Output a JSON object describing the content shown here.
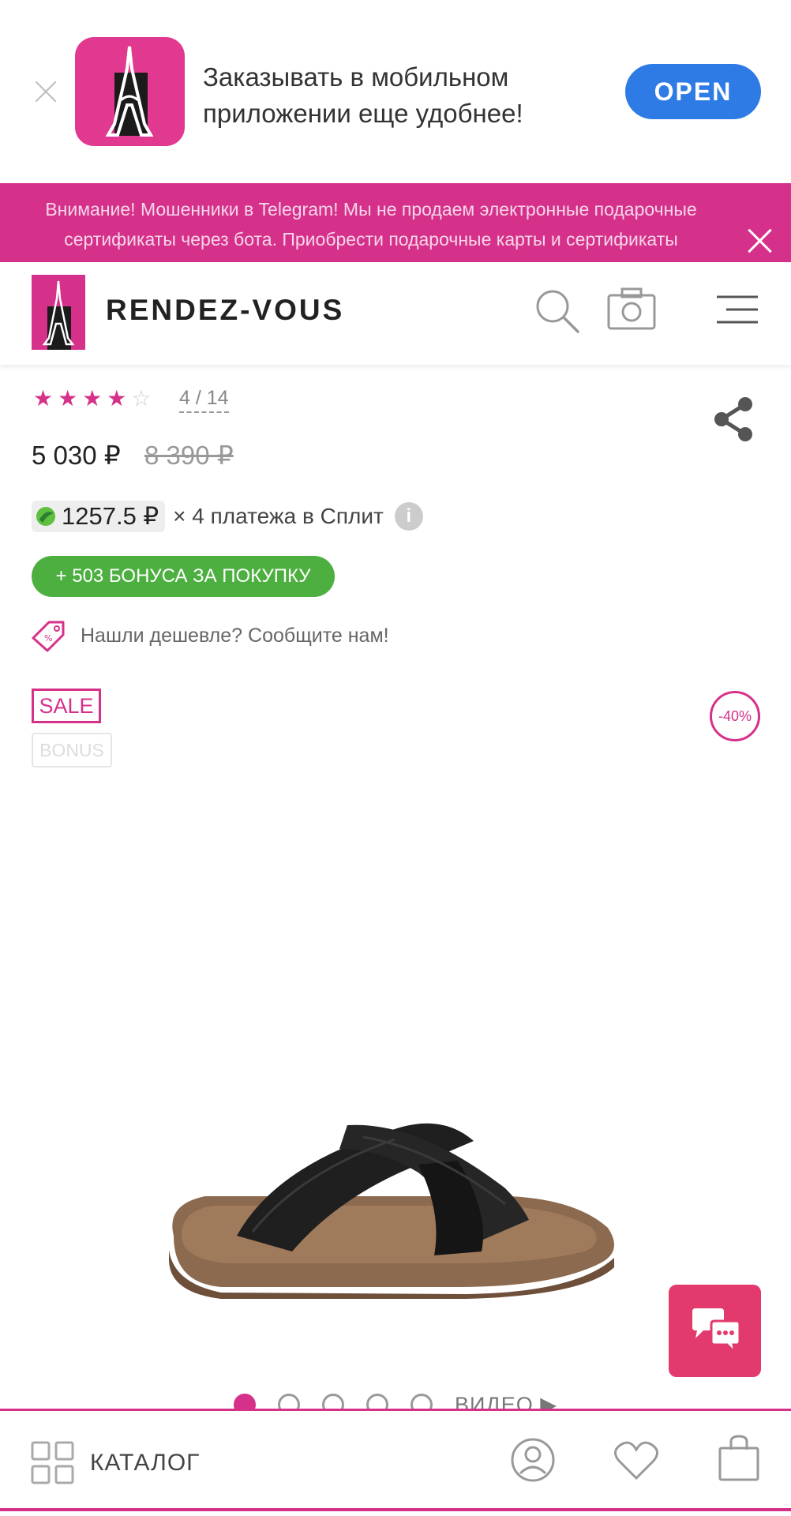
{
  "app_banner": {
    "text_line1": "Заказывать в мобильном",
    "text_line2": "приложении еще удобнее!",
    "open_label": "OPEN"
  },
  "warning": {
    "line1": "Внимание! Мошенники в Telegram! Мы не продаем электронные подарочные",
    "line2": "сертификаты через бота. Приобрести подарочные карты и сертификаты"
  },
  "header": {
    "brand": "RENDEZ-VOUS"
  },
  "product": {
    "rating_value": 4,
    "rating_max": 5,
    "rating_count": "4 / 14",
    "price_current": "5 030 ₽",
    "price_old": "8 390 ₽",
    "split_amount": "1257.5 ₽",
    "split_label": "× 4 платежа в Сплит",
    "split_info": "i",
    "bonus_button": "+ 503 БОНУСА ЗА ПОКУПКУ",
    "cheaper_text": "Нашли дешевле? Сообщите нам!",
    "sale_badge": "SALE",
    "bonus_badge": "BONUS",
    "discount_badge": "-40%"
  },
  "gallery": {
    "dot_count": 5,
    "active_index": 0,
    "video_label": "ВИДЕО"
  },
  "bottom_nav": {
    "catalog_label": "КАТАЛОГ"
  },
  "colors": {
    "brand_pink": "#d6318a",
    "open_blue": "#2f7be6",
    "bonus_green": "#4caf3f",
    "chat_red": "#e23a6c"
  }
}
